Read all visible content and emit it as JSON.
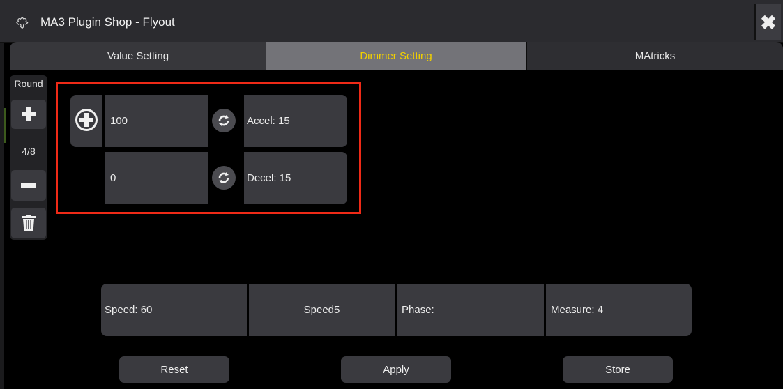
{
  "window": {
    "title": "MA3 Plugin Shop - Flyout",
    "close_icon": "close-x-icon"
  },
  "tabs": [
    {
      "label": "Value Setting",
      "active": false
    },
    {
      "label": "Dimmer Setting",
      "active": true
    },
    {
      "label": "MAtricks",
      "active": false
    }
  ],
  "sidebar": {
    "label": "Round",
    "count": "4/8",
    "icons": [
      "plus-icon",
      "minus-icon",
      "trash-icon"
    ]
  },
  "dimmer": {
    "rows": [
      {
        "value": "100",
        "ramp": "Accel: 15"
      },
      {
        "value": "0",
        "ramp": "Decel: 15"
      }
    ],
    "add_icon": "plus-circle-icon",
    "loop_icon": "loop-icon"
  },
  "speed_row": {
    "speed": "Speed: 60",
    "speed5": "Speed5",
    "phase": "Phase:",
    "measure": "Measure: 4"
  },
  "buttons": {
    "reset": "Reset",
    "apply": "Apply",
    "store": "Store"
  },
  "colors": {
    "active_tab_text": "#f2d000",
    "highlight": "#ef2a17",
    "panel": "#3a3a3f"
  }
}
